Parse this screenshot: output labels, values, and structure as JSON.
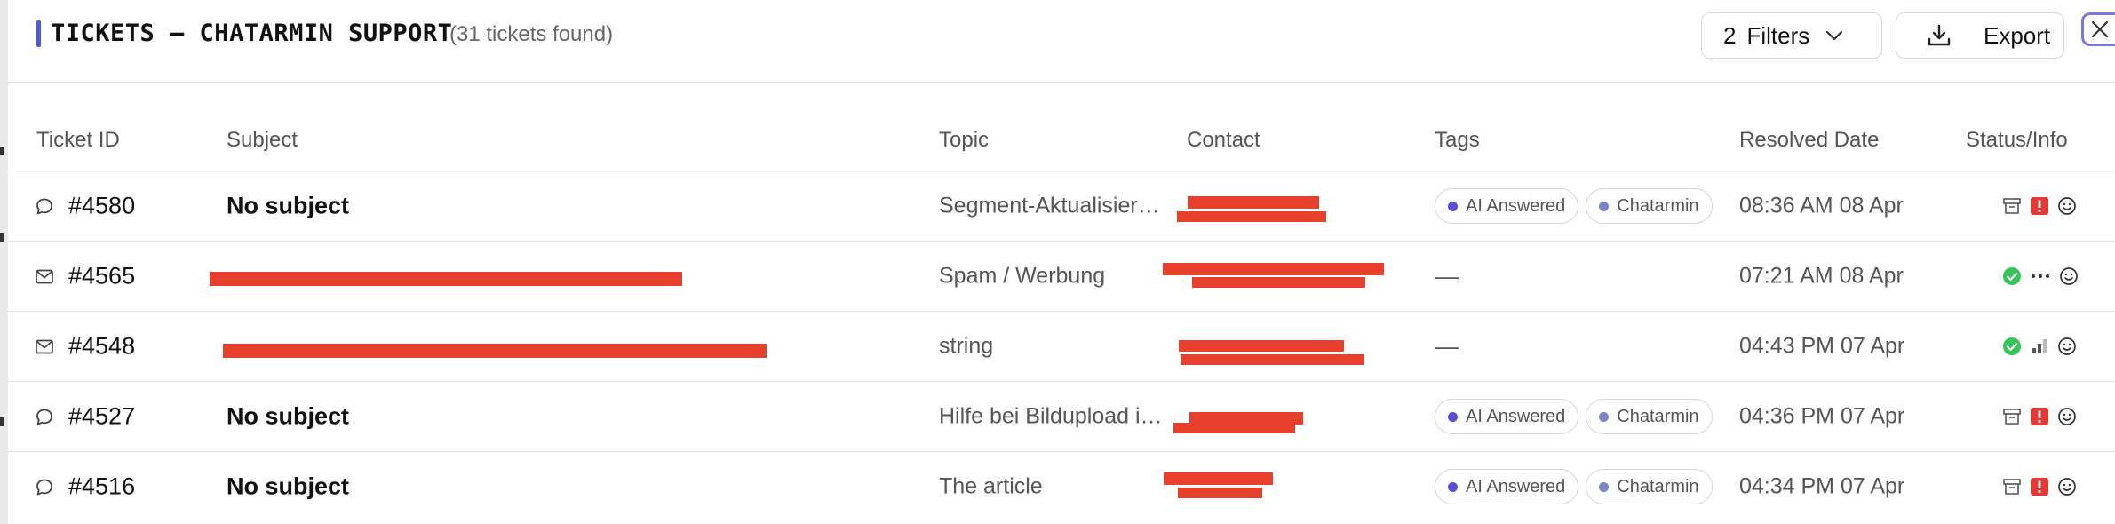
{
  "header": {
    "title": "TICKETS – CHATARMIN SUPPORT",
    "count_text": "(31 tickets found)",
    "filters_count": "2",
    "filters_label": "Filters",
    "export_label": "Export"
  },
  "columns": {
    "ticket_id": "Ticket ID",
    "subject": "Subject",
    "topic": "Topic",
    "contact": "Contact",
    "tags": "Tags",
    "resolved_date": "Resolved Date",
    "status_info": "Status/Info"
  },
  "rows": [
    {
      "id": "#4580",
      "channel": "chat",
      "subject": "No subject",
      "topic": "Segment-Aktualisier…",
      "tags": [
        "AI Answered",
        "Chatarmin"
      ],
      "resolved": "08:36 AM 08 Apr",
      "status_icons": [
        "archive-icon",
        "alert-icon",
        "smiley-icon"
      ]
    },
    {
      "id": "#4565",
      "channel": "email",
      "subject": "",
      "topic": "Spam / Werbung",
      "tags_empty": "—",
      "resolved": "07:21 AM 08 Apr",
      "status_icons": [
        "check-circle-icon",
        "more-icon",
        "smiley-icon"
      ]
    },
    {
      "id": "#4548",
      "channel": "email",
      "subject": "",
      "topic": "string",
      "tags_empty": "—",
      "resolved": "04:43 PM 07 Apr",
      "status_icons": [
        "check-circle-icon",
        "signal-bars-icon",
        "smiley-icon"
      ]
    },
    {
      "id": "#4527",
      "channel": "chat",
      "subject": "No subject",
      "topic": "Hilfe bei Bildupload i…",
      "tags": [
        "AI Answered",
        "Chatarmin"
      ],
      "resolved": "04:36 PM 07 Apr",
      "status_icons": [
        "archive-icon",
        "alert-icon",
        "smiley-icon"
      ]
    },
    {
      "id": "#4516",
      "channel": "chat",
      "subject": "No subject",
      "topic": "The article",
      "tags": [
        "AI Answered",
        "Chatarmin"
      ],
      "resolved": "04:34 PM 07 Apr",
      "status_icons": [
        "archive-icon",
        "alert-icon",
        "smiley-icon"
      ]
    }
  ],
  "colors": {
    "accent": "#4b5bdc",
    "redaction": "#e8402c",
    "tag_dot": "#5b4fd6",
    "success": "#34c45a",
    "alert": "#e53935"
  }
}
